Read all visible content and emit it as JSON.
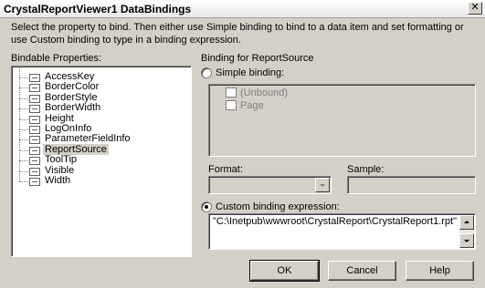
{
  "window": {
    "title": "CrystalReportViewer1 DataBindings",
    "close_glyph": "✕"
  },
  "intro": "Select the property to bind. Then either use Simple binding to bind to a data item and set formatting or use Custom binding to type in a binding expression.",
  "bindable": {
    "label": "Bindable Properties:",
    "items": [
      "AccessKey",
      "BorderColor",
      "BorderStyle",
      "BorderWidth",
      "Height",
      "LogOnInfo",
      "ParameterFieldInfo",
      "ReportSource",
      "ToolTip",
      "Visible",
      "Width"
    ],
    "selected": "ReportSource"
  },
  "binding": {
    "group_label": "Binding for ReportSource",
    "simple_label": "Simple binding:",
    "simple_checked": false,
    "simple_tree": [
      "(Unbound)",
      "Page"
    ],
    "format_label": "Format:",
    "sample_label": "Sample:",
    "custom_label": "Custom binding expression:",
    "custom_checked": true,
    "expression": "\"C:\\Inetpub\\wwwroot\\CrystalReport\\CrystalReport1.rpt\""
  },
  "buttons": {
    "ok": "OK",
    "cancel": "Cancel",
    "help": "Help"
  }
}
